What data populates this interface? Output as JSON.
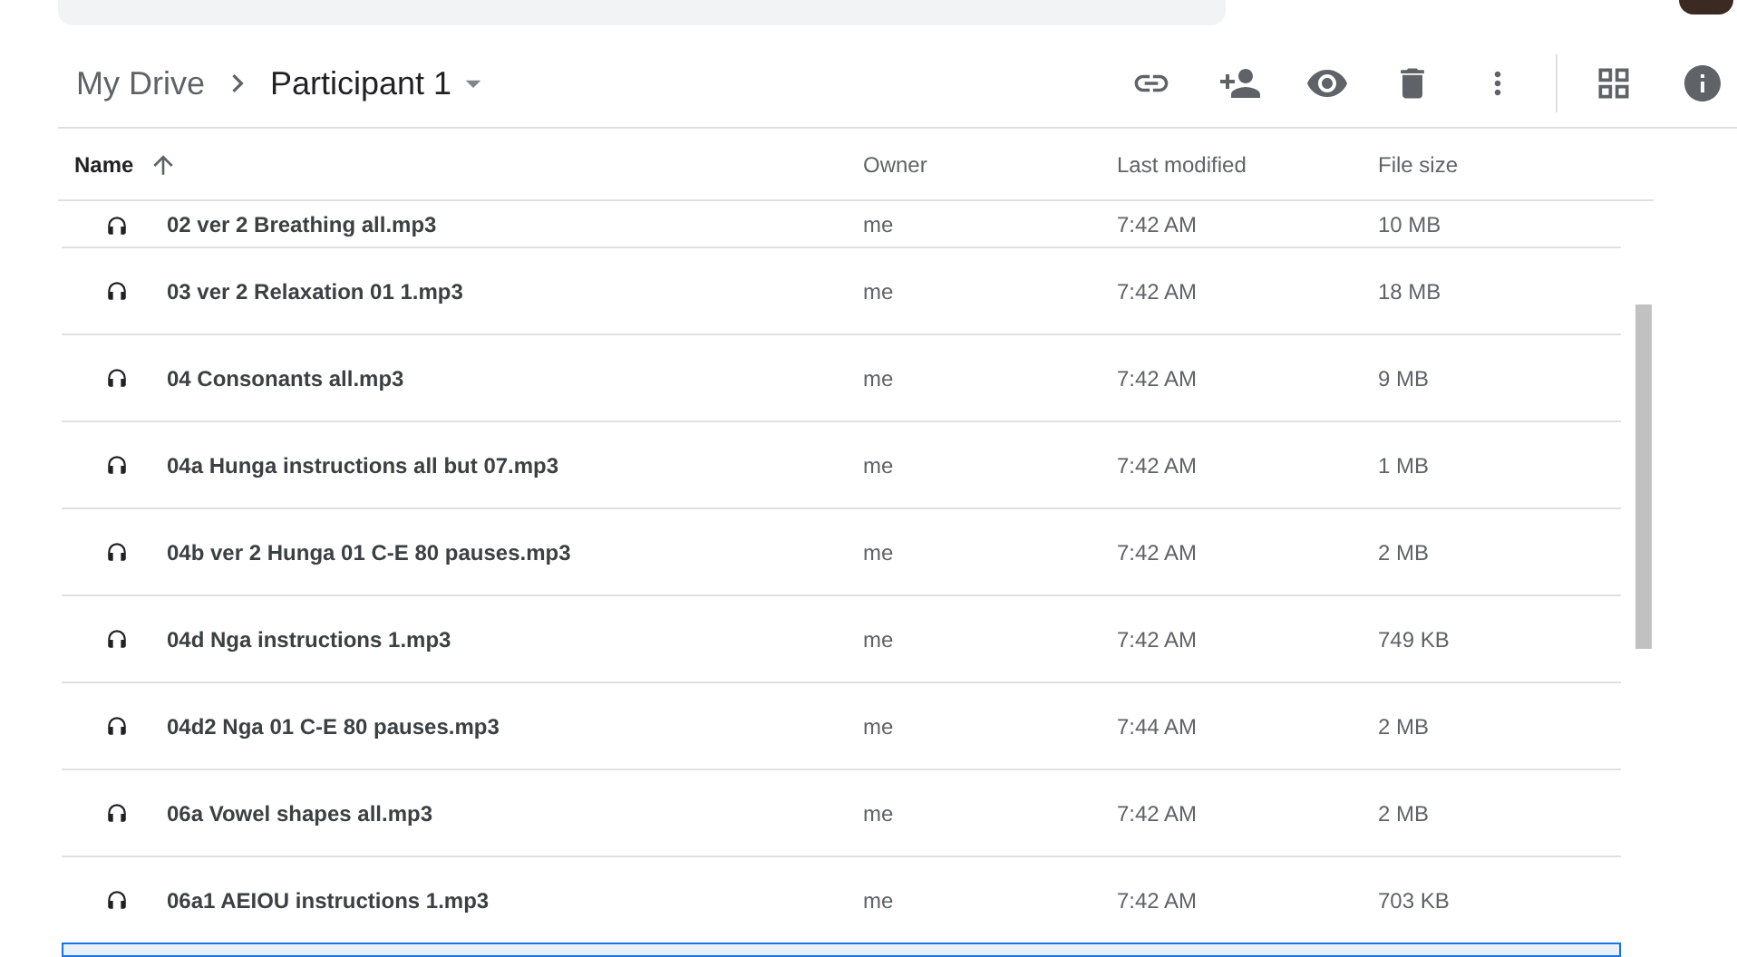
{
  "breadcrumb": [
    {
      "label": "My Drive",
      "current": false
    },
    {
      "label": "Participant 1",
      "current": true
    }
  ],
  "table": {
    "columns": [
      {
        "label": "Name",
        "sorted": true
      },
      {
        "label": "Owner",
        "sorted": false
      },
      {
        "label": "Last modified",
        "sorted": false
      },
      {
        "label": "File size",
        "sorted": false
      }
    ],
    "rows": [
      {
        "name": "02 ver 2 Breathing all.mp3",
        "owner": "me",
        "modified": "7:42 AM",
        "size": "10 MB",
        "selected": false
      },
      {
        "name": "03 ver 2 Relaxation 01 1.mp3",
        "owner": "me",
        "modified": "7:42 AM",
        "size": "18 MB",
        "selected": false
      },
      {
        "name": "04 Consonants all.mp3",
        "owner": "me",
        "modified": "7:42 AM",
        "size": "9 MB",
        "selected": false
      },
      {
        "name": "04a Hunga instructions all but 07.mp3",
        "owner": "me",
        "modified": "7:42 AM",
        "size": "1 MB",
        "selected": false
      },
      {
        "name": "04b ver 2 Hunga 01 C-E 80 pauses.mp3",
        "owner": "me",
        "modified": "7:42 AM",
        "size": "2 MB",
        "selected": false
      },
      {
        "name": "04d Nga instructions 1.mp3",
        "owner": "me",
        "modified": "7:42 AM",
        "size": "749 KB",
        "selected": false
      },
      {
        "name": "04d2 Nga 01 C-E 80 pauses.mp3",
        "owner": "me",
        "modified": "7:44 AM",
        "size": "2 MB",
        "selected": false
      },
      {
        "name": "06a Vowel shapes all.mp3",
        "owner": "me",
        "modified": "7:42 AM",
        "size": "2 MB",
        "selected": false
      },
      {
        "name": "06a1 AEIOU instructions 1.mp3",
        "owner": "me",
        "modified": "7:42 AM",
        "size": "703 KB",
        "selected": false
      }
    ]
  }
}
